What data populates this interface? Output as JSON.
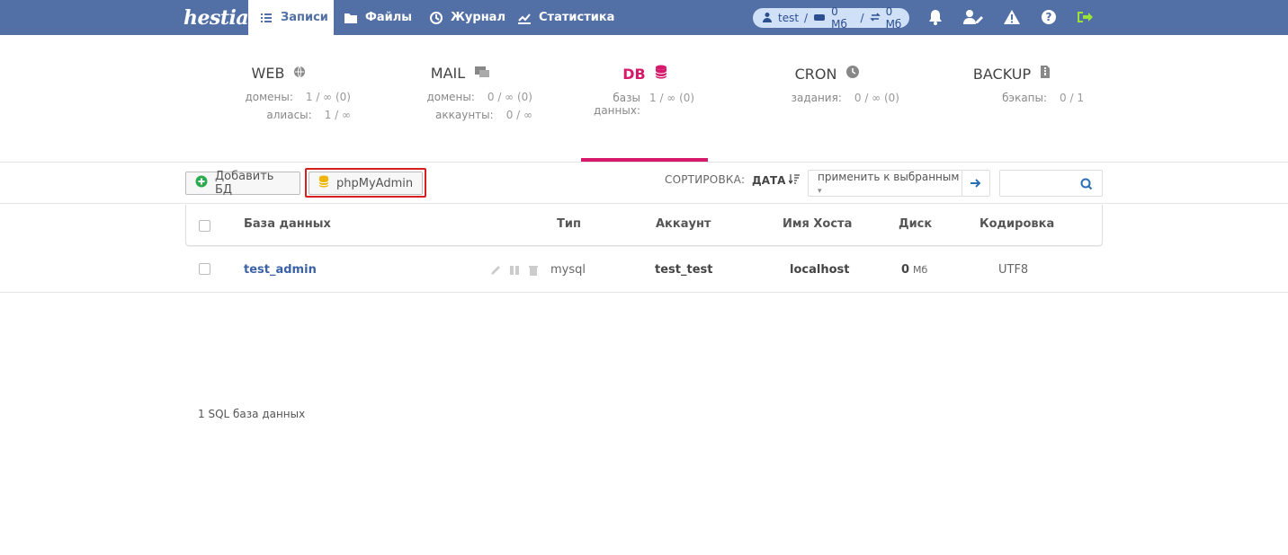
{
  "app": {
    "logo_text": "hestia",
    "nav": [
      {
        "label": "Записи"
      },
      {
        "label": "Файлы"
      },
      {
        "label": "Журнал"
      },
      {
        "label": "Статистика"
      }
    ],
    "user": {
      "name": "test",
      "disk": "0 Мб",
      "bandwidth": "0 Мб"
    }
  },
  "summary": {
    "tiles": [
      {
        "title": "WEB",
        "row1_label": "домены:",
        "row1_value": "1 / ∞ (0)",
        "row2_label": "алиасы:",
        "row2_value": "1 / ∞"
      },
      {
        "title": "MAIL",
        "row1_label": "домены:",
        "row1_value": "0 / ∞ (0)",
        "row2_label": "аккаунты:",
        "row2_value": "0 / ∞"
      },
      {
        "title": "DB",
        "row1_label": "базы данных:",
        "row1_value": "1 / ∞ (0)",
        "row2_label": "",
        "row2_value": ""
      },
      {
        "title": "CRON",
        "row1_label": "задания:",
        "row1_value": "0 / ∞ (0)",
        "row2_label": "",
        "row2_value": ""
      },
      {
        "title": "BACKUP",
        "row1_label": "бэкапы:",
        "row1_value": "0 / 1",
        "row2_label": "",
        "row2_value": ""
      }
    ]
  },
  "toolbar": {
    "add_db": "Добавить БД",
    "phpmyadmin": "phpMyAdmin",
    "sort_label": "СОРТИРОВКА:",
    "sort_value": "ДАТА",
    "apply_select": "применить к выбранным"
  },
  "table": {
    "headers": [
      "База данных",
      "Тип",
      "Аккаунт",
      "Имя Хоста",
      "Диск",
      "Кодировка"
    ],
    "rows": [
      {
        "name": "test_admin",
        "type": "mysql",
        "account": "test_test",
        "host": "localhost",
        "disk_value": "0",
        "disk_unit": "Мб",
        "encoding": "UTF8"
      }
    ]
  },
  "footer": {
    "count": "1 SQL база данных"
  },
  "colors": {
    "topbar": "#5370a6",
    "active_accent": "#d6196b",
    "highlight": "#d61f1f"
  }
}
